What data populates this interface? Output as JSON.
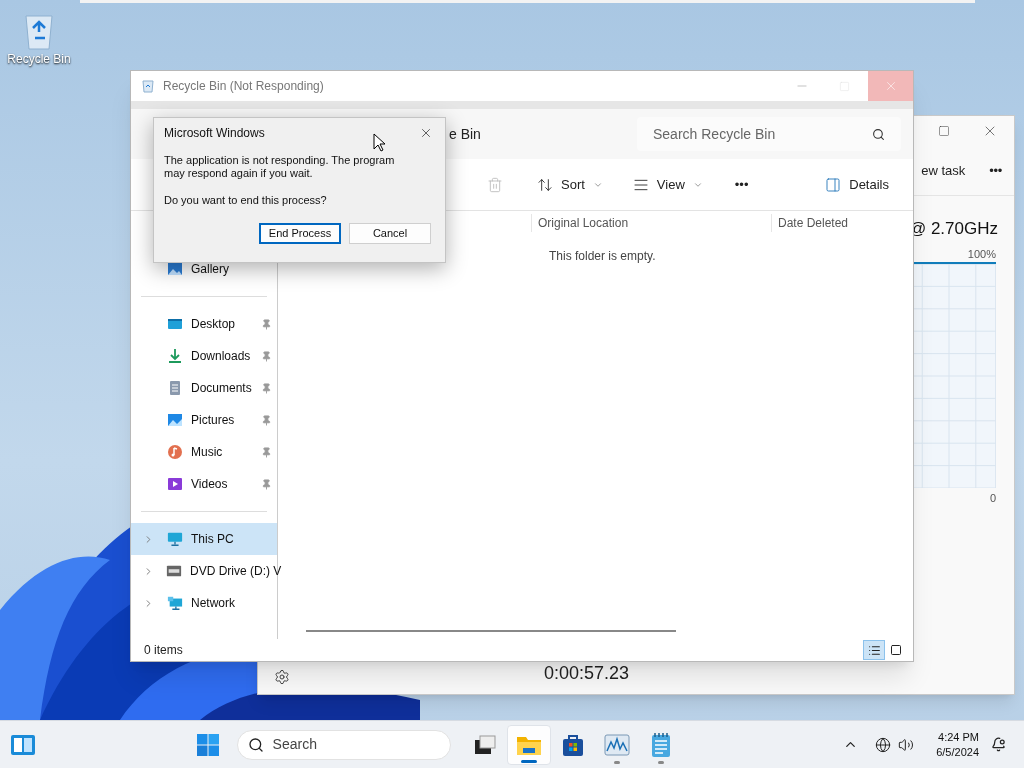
{
  "desktop_icons": [
    {
      "label": "Recycle Bin"
    }
  ],
  "task_manager": {
    "command": "ew task",
    "more": "•••",
    "cpu_name": "@ 2.70GHz",
    "graph_max": "100%",
    "graph_min": "0",
    "timer": "0:00:57.23"
  },
  "explorer": {
    "title": "Recycle Bin (Not Responding)",
    "address": "e Bin",
    "search": {
      "placeholder": "Search Recycle Bin"
    },
    "toolbar": [
      {
        "kind": "delete"
      },
      {
        "kind": "sort",
        "label": "Sort"
      },
      {
        "kind": "view",
        "label": "View"
      },
      {
        "kind": "more",
        "label": "•••"
      }
    ],
    "details": "Details",
    "columns": [
      "Original Location",
      "Date Deleted"
    ],
    "empty_message": "This folder is empty.",
    "sidebar": [
      {
        "items": [
          {
            "kind": "gallery",
            "label": "Gallery",
            "selected": false,
            "pinned": false,
            "expandable": false
          }
        ]
      },
      {
        "items": [
          {
            "kind": "desktop",
            "label": "Desktop",
            "selected": false,
            "pinned": true,
            "expandable": false
          },
          {
            "kind": "downloads",
            "label": "Downloads",
            "selected": false,
            "pinned": true,
            "expandable": false
          },
          {
            "kind": "documents",
            "label": "Documents",
            "selected": false,
            "pinned": true,
            "expandable": false
          },
          {
            "kind": "pictures",
            "label": "Pictures",
            "selected": false,
            "pinned": true,
            "expandable": false
          },
          {
            "kind": "music",
            "label": "Music",
            "selected": false,
            "pinned": true,
            "expandable": false
          },
          {
            "kind": "videos",
            "label": "Videos",
            "selected": false,
            "pinned": true,
            "expandable": false
          }
        ]
      },
      {
        "items": [
          {
            "kind": "pc",
            "label": "This PC",
            "selected": true,
            "pinned": false,
            "expandable": true
          },
          {
            "kind": "dvd",
            "label": "DVD Drive (D:) V",
            "selected": false,
            "pinned": false,
            "expandable": true
          },
          {
            "kind": "network",
            "label": "Network",
            "selected": false,
            "pinned": false,
            "expandable": true
          }
        ]
      }
    ],
    "status": "0 items",
    "view_modes": [
      {
        "kind": "details",
        "selected": true
      },
      {
        "kind": "tiles",
        "selected": false
      }
    ]
  },
  "dialog": {
    "title": "Microsoft Windows",
    "message": "The application is not responding. The program may respond again if you wait.",
    "question": "Do you want to end this process?",
    "buttons": [
      {
        "label": "End Process",
        "default": true
      },
      {
        "label": "Cancel",
        "default": false
      }
    ]
  },
  "taskbar": {
    "search": {
      "placeholder": "Search"
    },
    "apps": [
      {
        "kind": "taskview",
        "running": false,
        "active": false
      },
      {
        "kind": "explorer",
        "running": true,
        "active": true
      },
      {
        "kind": "store",
        "running": false,
        "active": false
      },
      {
        "kind": "taskmgr",
        "running": true,
        "active": false
      },
      {
        "kind": "notepad",
        "running": true,
        "active": false
      }
    ],
    "time": "4:24 PM",
    "date": "6/5/2024"
  }
}
